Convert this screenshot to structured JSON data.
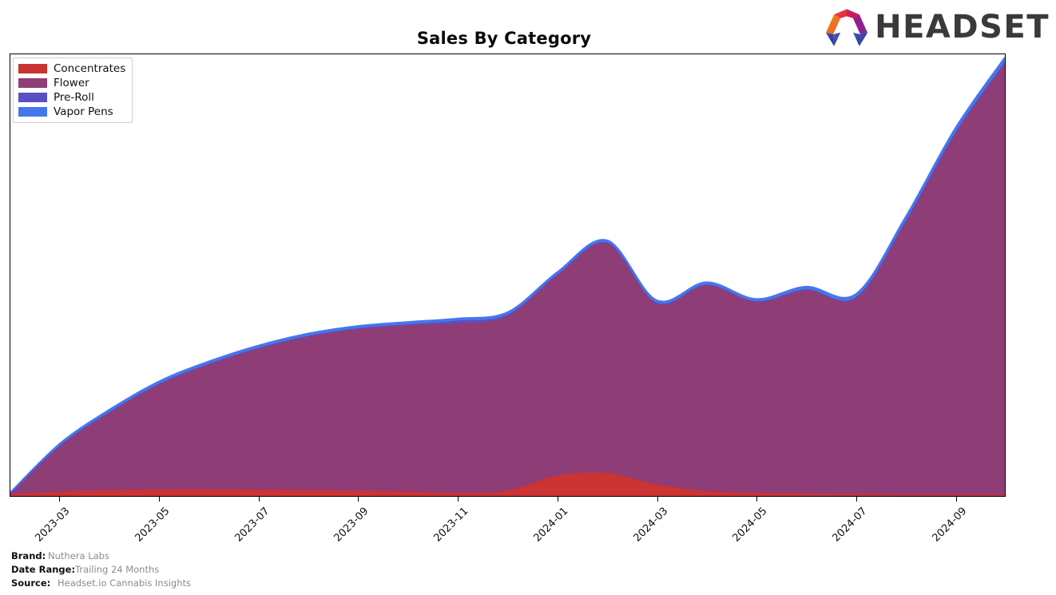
{
  "header": {
    "title": "Sales By Category",
    "logo_text": "HEADSET",
    "logo_icon": "headset-horseshoe-logo"
  },
  "legend": {
    "position": "top-left",
    "items": [
      {
        "label": "Concentrates",
        "color": "#cc3333"
      },
      {
        "label": "Flower",
        "color": "#8e3d77"
      },
      {
        "label": "Pre-Roll",
        "color": "#5b4fc4"
      },
      {
        "label": "Vapor Pens",
        "color": "#4477ee"
      }
    ]
  },
  "footer": {
    "rows": [
      {
        "key": "Brand:",
        "value": "Nuthera Labs"
      },
      {
        "key": "Date Range:",
        "value": "Trailing 24 Months"
      },
      {
        "key": "Source:",
        "value": "Headset.io Cannabis Insights"
      }
    ]
  },
  "chart_data": {
    "type": "area",
    "stacked": true,
    "title": "Sales By Category",
    "xlabel": "",
    "ylabel": "",
    "grid": false,
    "legend_position": "top-left",
    "axis_ticks": [
      "2023-03",
      "2023-05",
      "2023-07",
      "2023-09",
      "2023-11",
      "2024-01",
      "2024-03",
      "2024-05",
      "2024-07",
      "2024-09"
    ],
    "x": [
      "2023-02",
      "2023-03",
      "2023-04",
      "2023-05",
      "2023-06",
      "2023-07",
      "2023-08",
      "2023-09",
      "2023-10",
      "2023-11",
      "2023-12",
      "2024-01",
      "2024-02",
      "2024-03",
      "2024-04",
      "2024-05",
      "2024-06",
      "2024-07",
      "2024-08",
      "2024-09",
      "2024-10"
    ],
    "ylim": [
      0,
      100
    ],
    "series": [
      {
        "name": "Concentrates",
        "color": "#cc3333",
        "values": [
          0.4,
          1.0,
          1.3,
          1.5,
          1.5,
          1.4,
          1.3,
          1.2,
          1.0,
          0.7,
          1.2,
          4.6,
          5.2,
          2.6,
          1.1,
          0.7,
          0.5,
          0.4,
          0.3,
          0.3,
          0.3
        ]
      },
      {
        "name": "Flower",
        "color": "#8e3d77",
        "values": [
          0.3,
          10.5,
          17.8,
          24.0,
          28.5,
          32.2,
          35.0,
          36.8,
          37.8,
          38.4,
          39.6,
          45.6,
          52.2,
          41.2,
          46.8,
          43.4,
          46.3,
          44.6,
          62.0,
          82.0,
          98.0
        ]
      },
      {
        "name": "Pre-Roll",
        "color": "#5b4fc4",
        "values": [
          0.0,
          0.0,
          0.0,
          0.0,
          0.0,
          0.0,
          0.0,
          0.0,
          0.1,
          0.6,
          0.3,
          0.0,
          0.0,
          0.0,
          0.0,
          0.0,
          0.0,
          0.0,
          0.0,
          0.0,
          0.0
        ]
      },
      {
        "name": "Vapor Pens",
        "color": "#4477ee",
        "values": [
          0.1,
          0.4,
          0.5,
          0.5,
          0.5,
          0.5,
          0.5,
          0.5,
          0.5,
          0.5,
          0.5,
          0.5,
          0.5,
          0.5,
          0.5,
          0.5,
          0.6,
          0.7,
          0.8,
          0.9,
          1.0
        ]
      }
    ]
  }
}
